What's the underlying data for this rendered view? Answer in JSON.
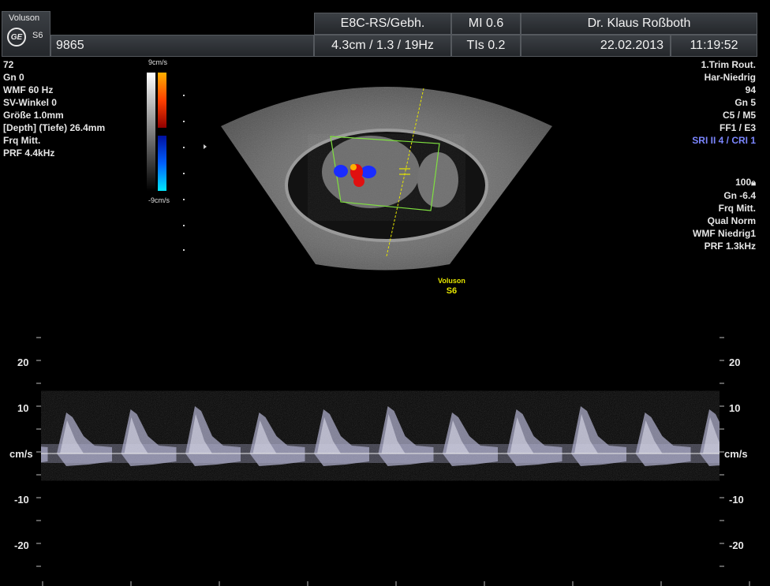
{
  "header": {
    "brand": "Voluson",
    "model": "S6",
    "logo_text": "GE",
    "patient_id": "9865",
    "probe_preset": "E8C-RS/Gebh.",
    "depth_info": "4.3cm / 1.3 / 19Hz",
    "mi": "MI  0.6",
    "tis": "TIs  0.2",
    "operator": "Dr. Klaus Roßboth",
    "date": "22.02.2013",
    "time": "11:19:52"
  },
  "left_params": [
    "72",
    "Gn   0",
    "WMF 60 Hz",
    "SV-Winkel  0",
    "Größe  1.0mm",
    "[Depth] (Tiefe) 26.4mm",
    "Frq Mitt.",
    "PRF  4.4kHz"
  ],
  "color_scale": {
    "top": "9cm/s",
    "bottom": "-9cm/s"
  },
  "right_params_top": [
    "1.Trim Rout.",
    "Har-Niedrig",
    "94",
    "Gn   5",
    "C5 / M5",
    "FF1 / E3",
    "SRI II 4 / CRI 1"
  ],
  "right_params_bottom": [
    "100",
    "Gn -6.4",
    "Frq Mitt.",
    "Qual Norm",
    "WMF Niedrig1",
    "PRF  1.3kHz"
  ],
  "image_watermark": {
    "line1": "Voluson",
    "line2": "S6"
  },
  "spectral": {
    "unit": "cm/s",
    "ticks": [
      "20",
      "10",
      "-10",
      "-20"
    ],
    "cycles": 10
  },
  "colors": {
    "accent_yellow": "#e6e600",
    "doppler_red": "#e01010",
    "doppler_blue": "#1a2cff",
    "roi_green": "#7fe040"
  }
}
